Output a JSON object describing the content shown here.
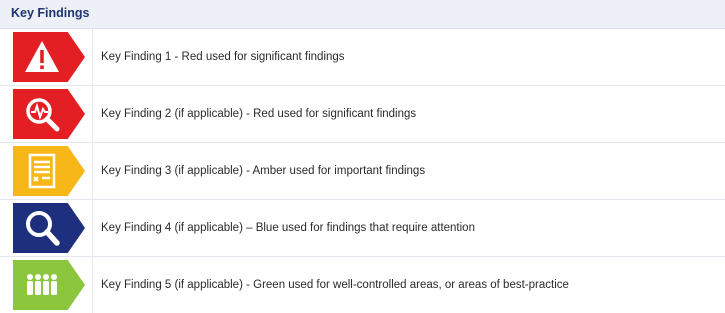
{
  "header": {
    "title": "Key Findings"
  },
  "findings": [
    {
      "label": "Key Finding 1 -  Red used for significant findings",
      "color": "#e41f24",
      "icon": "warning-triangle-icon"
    },
    {
      "label": "Key Finding 2 (if applicable) -  Red used for significant findings",
      "color": "#e41f24",
      "icon": "magnifier-pulse-icon"
    },
    {
      "label": "Key Finding 3 (if applicable) - Amber used for important findings",
      "color": "#f7b719",
      "icon": "document-form-icon"
    },
    {
      "label": "Key Finding 4 (if applicable) – Blue used for findings that require attention",
      "color": "#1d2f7d",
      "icon": "magnifier-icon"
    },
    {
      "label": "Key Finding 5 (if applicable) - Green used for well-controlled areas, or areas of best-practice",
      "color": "#8cc63f",
      "icon": "people-group-icon"
    }
  ]
}
